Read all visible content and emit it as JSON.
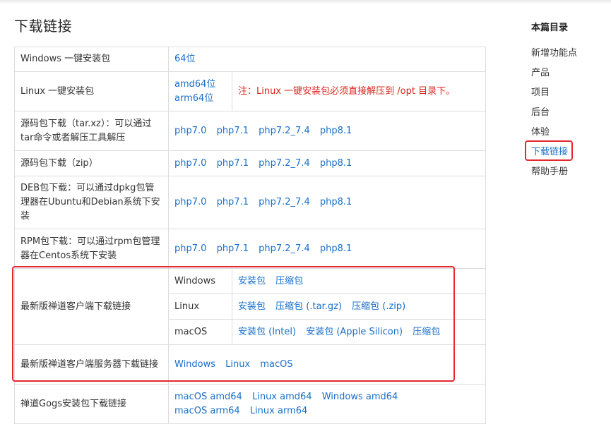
{
  "page": {
    "title": "下载链接"
  },
  "table": {
    "windows_row": {
      "label": "Windows 一键安装包",
      "links": [
        "64位"
      ]
    },
    "linux_row": {
      "label": "Linux 一键安装包",
      "links": [
        "amd64位",
        "arm64位"
      ],
      "note": "注：Linux 一键安装包必须直接解压到 /opt 目录下。"
    },
    "source_tar_row": {
      "label": "源码包下载（tar.xz）：可以通过tar命令或者解压工具解压",
      "links": [
        "php7.0",
        "php7.1",
        "php7.2_7.4",
        "php8.1"
      ]
    },
    "source_zip_row": {
      "label": "源码包下载（zip）",
      "links": [
        "php7.0",
        "php7.1",
        "php7.2_7.4",
        "php8.1"
      ]
    },
    "deb_row": {
      "label": "DEB包下载：可以通过dpkg包管理器在Ubuntu和Debian系统下安装",
      "links": [
        "php7.0",
        "php7.1",
        "php7.2_7.4",
        "php8.1"
      ]
    },
    "rpm_row": {
      "label": "RPM包下载：可以通过rpm包管理器在Centos系统下安装",
      "links": [
        "php7.0",
        "php7.1",
        "php7.2_7.4",
        "php8.1"
      ]
    },
    "client_row": {
      "label": "最新版禅道客户端下载链接",
      "platforms": [
        {
          "name": "Windows",
          "links": [
            "安装包",
            "压缩包"
          ]
        },
        {
          "name": "Linux",
          "links": [
            "安装包",
            "压缩包 (.tar.gz)",
            "压缩包 (.zip)"
          ]
        },
        {
          "name": "macOS",
          "links": [
            "安装包 (Intel)",
            "安装包 (Apple Silicon)",
            "压缩包"
          ]
        }
      ]
    },
    "client_server_row": {
      "label": "最新版禅道客户端服务器下载链接",
      "links": [
        "Windows",
        "Linux",
        "macOS"
      ]
    },
    "gogs_row": {
      "label": "禅道Gogs安装包下载链接",
      "links": [
        "macOS amd64",
        "Linux amd64",
        "Windows amd64",
        "macOS arm64",
        "Linux arm64"
      ]
    }
  },
  "toc": {
    "title": "本篇目录",
    "items": [
      "新增功能点",
      "产品",
      "项目",
      "后台",
      "体验",
      "下载链接",
      "帮助手册"
    ],
    "active_index": 5
  },
  "colors": {
    "link": "#1a6fc9",
    "note": "#d9261c",
    "highlight": "#e5272f"
  }
}
